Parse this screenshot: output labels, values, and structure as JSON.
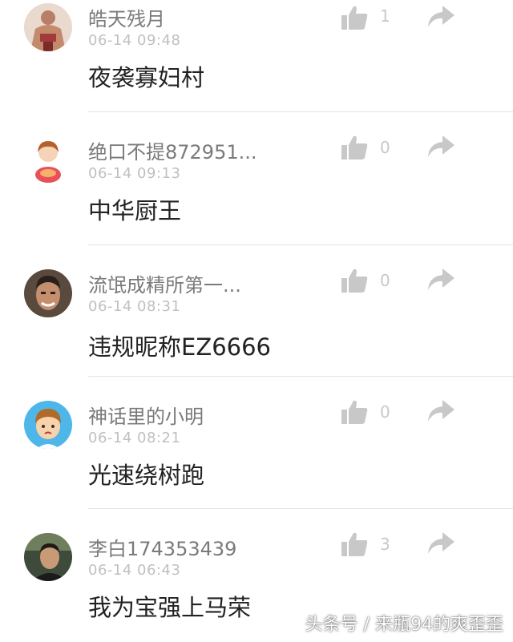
{
  "comments": [
    {
      "username": "皓天残月",
      "time": "06-14 09:48",
      "content": "夜袭寡妇村",
      "likes": "1",
      "avatar_icon": "avatar-wrestler",
      "like_icon": "thumbs-up-icon",
      "share_icon": "share-arrow-icon"
    },
    {
      "username": "绝口不提872951...",
      "time": "06-14 09:13",
      "content": "中华厨王",
      "likes": "0",
      "avatar_icon": "avatar-cartoon-girl",
      "like_icon": "thumbs-up-icon",
      "share_icon": "share-arrow-icon"
    },
    {
      "username": "流氓成精所第一...",
      "time": "06-14 08:31",
      "content": "违规昵称EZ6666",
      "likes": "0",
      "avatar_icon": "avatar-man-photo",
      "like_icon": "thumbs-up-icon",
      "share_icon": "share-arrow-icon"
    },
    {
      "username": "神话里的小明",
      "time": "06-14 08:21",
      "content": "光速绕树跑",
      "likes": "0",
      "avatar_icon": "avatar-cartoon-boy",
      "like_icon": "thumbs-up-icon",
      "share_icon": "share-arrow-icon"
    },
    {
      "username": "李白174353439",
      "time": "06-14 06:43",
      "content": "我为宝强上马荣",
      "likes": "3",
      "avatar_icon": "avatar-man-car",
      "like_icon": "thumbs-up-icon",
      "share_icon": "share-arrow-icon"
    }
  ],
  "watermark": "头条号 / 来瓶94的爽歪歪",
  "colors": {
    "username": "#7a7a7a",
    "time": "#c0c0c0",
    "content": "#222222",
    "icon": "#c8c8c8",
    "divider": "#e4e4e4"
  }
}
